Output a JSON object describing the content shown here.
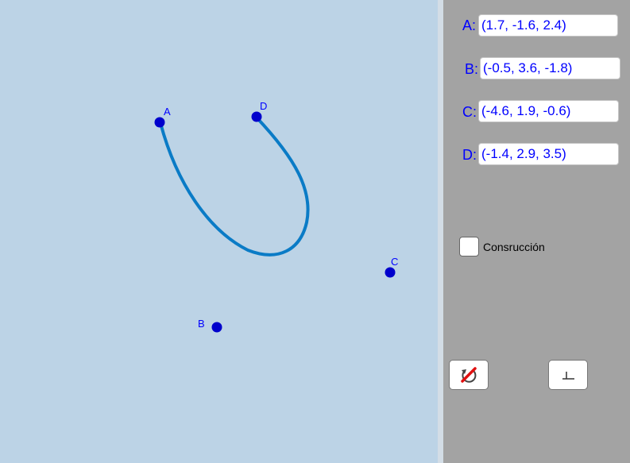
{
  "points": {
    "A": {
      "label": "A"
    },
    "B": {
      "label": "B"
    },
    "C": {
      "label": "C"
    },
    "D": {
      "label": "D"
    }
  },
  "inputs": [
    {
      "label": "A:",
      "value": "(1.7, -1.6, 2.4)"
    },
    {
      "label": "B:",
      "value": "(-0.5, 3.6, -1.8)"
    },
    {
      "label": "C:",
      "value": "(-4.6, 1.9, -0.6)"
    },
    {
      "label": "D:",
      "value": "(-1.4, 2.9, 3.5)"
    }
  ],
  "checkbox": {
    "label": "Consrucción",
    "checked": false
  },
  "tools": {
    "reset_icon": "reset-icon",
    "axes_icon": "axes-icon"
  },
  "colors": {
    "canvas": "#bcd3e6",
    "panel": "#a3a3a3",
    "point": "#0000cc",
    "curve": "#0a7bc6",
    "label": "#0000ff"
  }
}
